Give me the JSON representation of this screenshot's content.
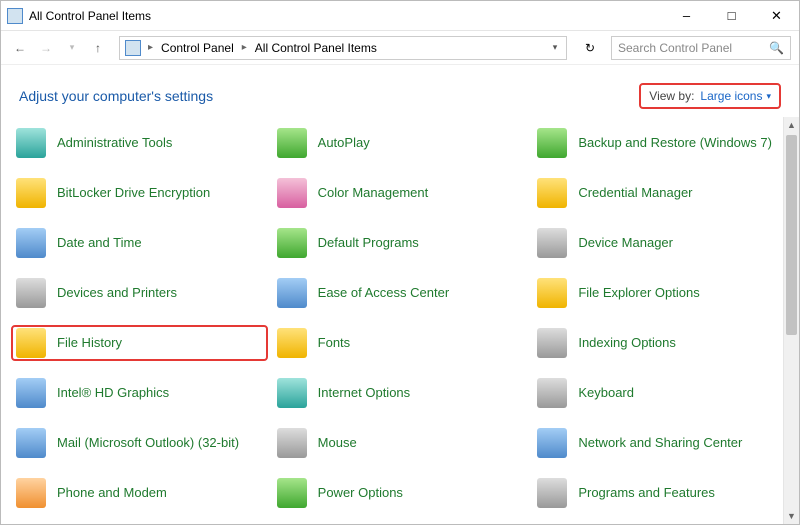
{
  "window": {
    "title": "All Control Panel Items"
  },
  "breadcrumb": {
    "root": "Control Panel",
    "current": "All Control Panel Items"
  },
  "search": {
    "placeholder": "Search Control Panel"
  },
  "heading": "Adjust your computer's settings",
  "viewby": {
    "label": "View by:",
    "value": "Large icons"
  },
  "items": [
    {
      "label": "Administrative Tools",
      "icon": "c-teal",
      "name": "administrative-tools"
    },
    {
      "label": "AutoPlay",
      "icon": "c-green",
      "name": "autoplay"
    },
    {
      "label": "Backup and Restore (Windows 7)",
      "icon": "c-green",
      "name": "backup-and-restore"
    },
    {
      "label": "BitLocker Drive Encryption",
      "icon": "c-yellow",
      "name": "bitlocker-drive-encryption"
    },
    {
      "label": "Color Management",
      "icon": "c-pink",
      "name": "color-management"
    },
    {
      "label": "Credential Manager",
      "icon": "c-yellow",
      "name": "credential-manager"
    },
    {
      "label": "Date and Time",
      "icon": "c-blue",
      "name": "date-and-time"
    },
    {
      "label": "Default Programs",
      "icon": "c-green",
      "name": "default-programs"
    },
    {
      "label": "Device Manager",
      "icon": "c-grey",
      "name": "device-manager"
    },
    {
      "label": "Devices and Printers",
      "icon": "c-grey",
      "name": "devices-and-printers"
    },
    {
      "label": "Ease of Access Center",
      "icon": "c-blue",
      "name": "ease-of-access-center"
    },
    {
      "label": "File Explorer Options",
      "icon": "c-yellow",
      "name": "file-explorer-options"
    },
    {
      "label": "File History",
      "icon": "c-yellow",
      "name": "file-history",
      "highlight": true
    },
    {
      "label": "Fonts",
      "icon": "c-yellow",
      "name": "fonts"
    },
    {
      "label": "Indexing Options",
      "icon": "c-grey",
      "name": "indexing-options"
    },
    {
      "label": "Intel® HD Graphics",
      "icon": "c-blue",
      "name": "intel-hd-graphics"
    },
    {
      "label": "Internet Options",
      "icon": "c-teal",
      "name": "internet-options"
    },
    {
      "label": "Keyboard",
      "icon": "c-grey",
      "name": "keyboard"
    },
    {
      "label": "Mail (Microsoft Outlook) (32-bit)",
      "icon": "c-blue",
      "name": "mail-outlook"
    },
    {
      "label": "Mouse",
      "icon": "c-grey",
      "name": "mouse"
    },
    {
      "label": "Network and Sharing Center",
      "icon": "c-blue",
      "name": "network-and-sharing-center"
    },
    {
      "label": "Phone and Modem",
      "icon": "c-orange",
      "name": "phone-and-modem"
    },
    {
      "label": "Power Options",
      "icon": "c-green",
      "name": "power-options"
    },
    {
      "label": "Programs and Features",
      "icon": "c-grey",
      "name": "programs-and-features"
    }
  ]
}
